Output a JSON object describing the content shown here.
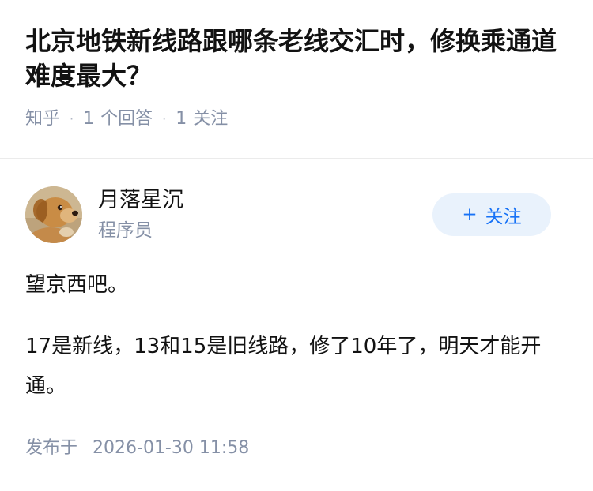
{
  "question": {
    "title": "北京地铁新线路跟哪条老线交汇时，修换乘通道难度最大？",
    "source": "知乎",
    "answers_count": "1",
    "answers_label": "个回答",
    "followers_count": "1",
    "followers_label": "关注"
  },
  "author": {
    "name": "月落星沉",
    "title": "程序员",
    "avatar_icon": "dog-avatar-icon",
    "follow_label": "关注",
    "follow_icon": "plus-icon"
  },
  "answer": {
    "paragraphs": [
      "望京西吧。",
      "17是新线，13和15是旧线路，修了10年了，明天才能开通。"
    ]
  },
  "footer": {
    "published_label": "发布于",
    "published_time": "2026-01-30 11:58"
  },
  "colors": {
    "title": "#121212",
    "meta": "#8590a6",
    "accent": "#1772f6",
    "button_bg": "#e9f2fc",
    "divider": "#ebebeb"
  }
}
